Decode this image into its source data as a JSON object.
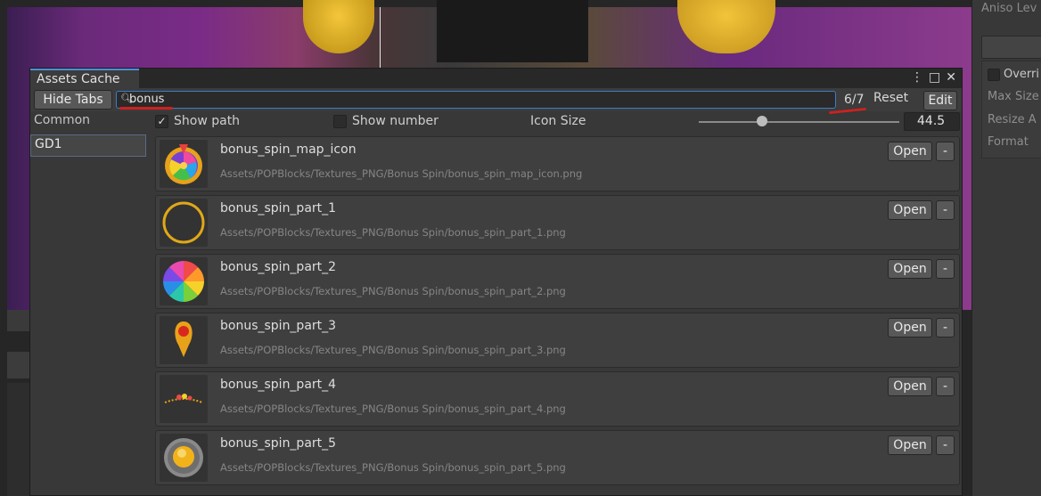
{
  "window": {
    "tab_title": "Assets Cache",
    "menu_icon": "kebab-menu-icon",
    "maximize_icon": "maximize-icon",
    "close_icon": "close-icon"
  },
  "toolbar": {
    "hide_tabs_label": "Hide Tabs",
    "search_icon": "search-icon",
    "search_value": "bonus",
    "count": "6/7",
    "reset_label": "Reset",
    "edit_label": "Edit"
  },
  "sidebar": {
    "items": [
      {
        "label": "Common",
        "selected": false
      },
      {
        "label": "GD1",
        "selected": true
      }
    ]
  },
  "options": {
    "show_path_label": "Show path",
    "show_path_checked": true,
    "show_number_label": "Show number",
    "show_number_checked": false,
    "icon_size_label": "Icon Size",
    "icon_size_value": "44.5"
  },
  "assets": [
    {
      "name": "bonus_spin_map_icon",
      "path": "Assets/POPBlocks/Textures_PNG/Bonus Spin/bonus_spin_map_icon.png",
      "open_label": "Open",
      "remove_label": "-"
    },
    {
      "name": "bonus_spin_part_1",
      "path": "Assets/POPBlocks/Textures_PNG/Bonus Spin/bonus_spin_part_1.png",
      "open_label": "Open",
      "remove_label": "-"
    },
    {
      "name": "bonus_spin_part_2",
      "path": "Assets/POPBlocks/Textures_PNG/Bonus Spin/bonus_spin_part_2.png",
      "open_label": "Open",
      "remove_label": "-"
    },
    {
      "name": "bonus_spin_part_3",
      "path": "Assets/POPBlocks/Textures_PNG/Bonus Spin/bonus_spin_part_3.png",
      "open_label": "Open",
      "remove_label": "-"
    },
    {
      "name": "bonus_spin_part_4",
      "path": "Assets/POPBlocks/Textures_PNG/Bonus Spin/bonus_spin_part_4.png",
      "open_label": "Open",
      "remove_label": "-"
    },
    {
      "name": "bonus_spin_part_5",
      "path": "Assets/POPBlocks/Textures_PNG/Bonus Spin/bonus_spin_part_5.png",
      "open_label": "Open",
      "remove_label": "-"
    }
  ],
  "inspector": {
    "top_label": "Aniso Lev",
    "override_label": "Overri",
    "max_size_label": "Max Size",
    "resize_label": "Resize A",
    "format_label": "Format"
  },
  "colors": {
    "accent": "#4d8fd9",
    "annotation_red": "#d02020",
    "panel_bg": "#383838"
  }
}
